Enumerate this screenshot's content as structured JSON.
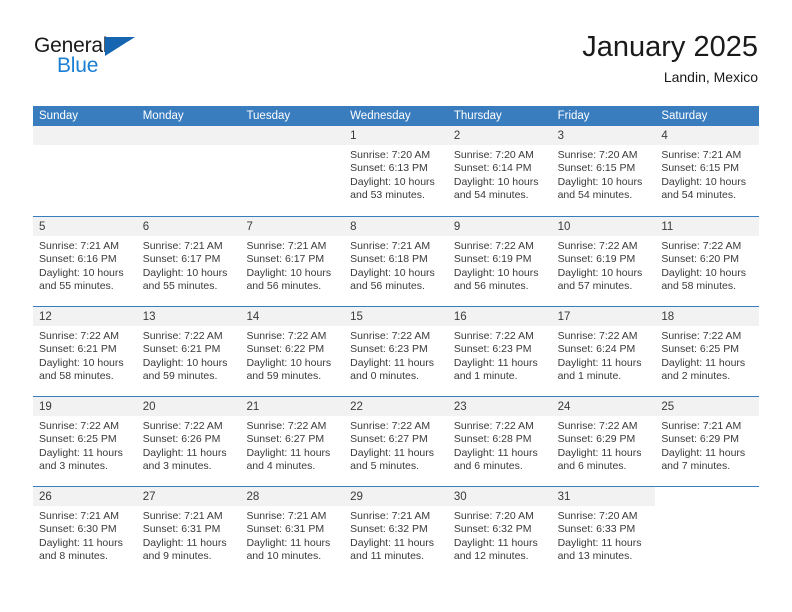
{
  "brand": {
    "name_top": "General",
    "name_bottom": "Blue",
    "accent_color": "#1b7fd4",
    "flag_color": "#1565b0"
  },
  "header": {
    "title": "January 2025",
    "subtitle": "Landin, Mexico"
  },
  "calendar": {
    "header_color": "#3a7dbf",
    "cell_strip_color": "#f2f2f2",
    "weekdays": [
      "Sunday",
      "Monday",
      "Tuesday",
      "Wednesday",
      "Thursday",
      "Friday",
      "Saturday"
    ],
    "weeks": [
      [
        {
          "day": "",
          "empty": true
        },
        {
          "day": "",
          "empty": true
        },
        {
          "day": "",
          "empty": true
        },
        {
          "day": "1",
          "sunrise": "Sunrise: 7:20 AM",
          "sunset": "Sunset: 6:13 PM",
          "daylight_1": "Daylight: 10 hours",
          "daylight_2": "and 53 minutes."
        },
        {
          "day": "2",
          "sunrise": "Sunrise: 7:20 AM",
          "sunset": "Sunset: 6:14 PM",
          "daylight_1": "Daylight: 10 hours",
          "daylight_2": "and 54 minutes."
        },
        {
          "day": "3",
          "sunrise": "Sunrise: 7:20 AM",
          "sunset": "Sunset: 6:15 PM",
          "daylight_1": "Daylight: 10 hours",
          "daylight_2": "and 54 minutes."
        },
        {
          "day": "4",
          "sunrise": "Sunrise: 7:21 AM",
          "sunset": "Sunset: 6:15 PM",
          "daylight_1": "Daylight: 10 hours",
          "daylight_2": "and 54 minutes."
        }
      ],
      [
        {
          "day": "5",
          "sunrise": "Sunrise: 7:21 AM",
          "sunset": "Sunset: 6:16 PM",
          "daylight_1": "Daylight: 10 hours",
          "daylight_2": "and 55 minutes."
        },
        {
          "day": "6",
          "sunrise": "Sunrise: 7:21 AM",
          "sunset": "Sunset: 6:17 PM",
          "daylight_1": "Daylight: 10 hours",
          "daylight_2": "and 55 minutes."
        },
        {
          "day": "7",
          "sunrise": "Sunrise: 7:21 AM",
          "sunset": "Sunset: 6:17 PM",
          "daylight_1": "Daylight: 10 hours",
          "daylight_2": "and 56 minutes."
        },
        {
          "day": "8",
          "sunrise": "Sunrise: 7:21 AM",
          "sunset": "Sunset: 6:18 PM",
          "daylight_1": "Daylight: 10 hours",
          "daylight_2": "and 56 minutes."
        },
        {
          "day": "9",
          "sunrise": "Sunrise: 7:22 AM",
          "sunset": "Sunset: 6:19 PM",
          "daylight_1": "Daylight: 10 hours",
          "daylight_2": "and 56 minutes."
        },
        {
          "day": "10",
          "sunrise": "Sunrise: 7:22 AM",
          "sunset": "Sunset: 6:19 PM",
          "daylight_1": "Daylight: 10 hours",
          "daylight_2": "and 57 minutes."
        },
        {
          "day": "11",
          "sunrise": "Sunrise: 7:22 AM",
          "sunset": "Sunset: 6:20 PM",
          "daylight_1": "Daylight: 10 hours",
          "daylight_2": "and 58 minutes."
        }
      ],
      [
        {
          "day": "12",
          "sunrise": "Sunrise: 7:22 AM",
          "sunset": "Sunset: 6:21 PM",
          "daylight_1": "Daylight: 10 hours",
          "daylight_2": "and 58 minutes."
        },
        {
          "day": "13",
          "sunrise": "Sunrise: 7:22 AM",
          "sunset": "Sunset: 6:21 PM",
          "daylight_1": "Daylight: 10 hours",
          "daylight_2": "and 59 minutes."
        },
        {
          "day": "14",
          "sunrise": "Sunrise: 7:22 AM",
          "sunset": "Sunset: 6:22 PM",
          "daylight_1": "Daylight: 10 hours",
          "daylight_2": "and 59 minutes."
        },
        {
          "day": "15",
          "sunrise": "Sunrise: 7:22 AM",
          "sunset": "Sunset: 6:23 PM",
          "daylight_1": "Daylight: 11 hours",
          "daylight_2": "and 0 minutes."
        },
        {
          "day": "16",
          "sunrise": "Sunrise: 7:22 AM",
          "sunset": "Sunset: 6:23 PM",
          "daylight_1": "Daylight: 11 hours",
          "daylight_2": "and 1 minute."
        },
        {
          "day": "17",
          "sunrise": "Sunrise: 7:22 AM",
          "sunset": "Sunset: 6:24 PM",
          "daylight_1": "Daylight: 11 hours",
          "daylight_2": "and 1 minute."
        },
        {
          "day": "18",
          "sunrise": "Sunrise: 7:22 AM",
          "sunset": "Sunset: 6:25 PM",
          "daylight_1": "Daylight: 11 hours",
          "daylight_2": "and 2 minutes."
        }
      ],
      [
        {
          "day": "19",
          "sunrise": "Sunrise: 7:22 AM",
          "sunset": "Sunset: 6:25 PM",
          "daylight_1": "Daylight: 11 hours",
          "daylight_2": "and 3 minutes."
        },
        {
          "day": "20",
          "sunrise": "Sunrise: 7:22 AM",
          "sunset": "Sunset: 6:26 PM",
          "daylight_1": "Daylight: 11 hours",
          "daylight_2": "and 3 minutes."
        },
        {
          "day": "21",
          "sunrise": "Sunrise: 7:22 AM",
          "sunset": "Sunset: 6:27 PM",
          "daylight_1": "Daylight: 11 hours",
          "daylight_2": "and 4 minutes."
        },
        {
          "day": "22",
          "sunrise": "Sunrise: 7:22 AM",
          "sunset": "Sunset: 6:27 PM",
          "daylight_1": "Daylight: 11 hours",
          "daylight_2": "and 5 minutes."
        },
        {
          "day": "23",
          "sunrise": "Sunrise: 7:22 AM",
          "sunset": "Sunset: 6:28 PM",
          "daylight_1": "Daylight: 11 hours",
          "daylight_2": "and 6 minutes."
        },
        {
          "day": "24",
          "sunrise": "Sunrise: 7:22 AM",
          "sunset": "Sunset: 6:29 PM",
          "daylight_1": "Daylight: 11 hours",
          "daylight_2": "and 6 minutes."
        },
        {
          "day": "25",
          "sunrise": "Sunrise: 7:21 AM",
          "sunset": "Sunset: 6:29 PM",
          "daylight_1": "Daylight: 11 hours",
          "daylight_2": "and 7 minutes."
        }
      ],
      [
        {
          "day": "26",
          "sunrise": "Sunrise: 7:21 AM",
          "sunset": "Sunset: 6:30 PM",
          "daylight_1": "Daylight: 11 hours",
          "daylight_2": "and 8 minutes."
        },
        {
          "day": "27",
          "sunrise": "Sunrise: 7:21 AM",
          "sunset": "Sunset: 6:31 PM",
          "daylight_1": "Daylight: 11 hours",
          "daylight_2": "and 9 minutes."
        },
        {
          "day": "28",
          "sunrise": "Sunrise: 7:21 AM",
          "sunset": "Sunset: 6:31 PM",
          "daylight_1": "Daylight: 11 hours",
          "daylight_2": "and 10 minutes."
        },
        {
          "day": "29",
          "sunrise": "Sunrise: 7:21 AM",
          "sunset": "Sunset: 6:32 PM",
          "daylight_1": "Daylight: 11 hours",
          "daylight_2": "and 11 minutes."
        },
        {
          "day": "30",
          "sunrise": "Sunrise: 7:20 AM",
          "sunset": "Sunset: 6:32 PM",
          "daylight_1": "Daylight: 11 hours",
          "daylight_2": "and 12 minutes."
        },
        {
          "day": "31",
          "sunrise": "Sunrise: 7:20 AM",
          "sunset": "Sunset: 6:33 PM",
          "daylight_1": "Daylight: 11 hours",
          "daylight_2": "and 13 minutes."
        },
        {
          "day": "",
          "empty": true,
          "blank_tail": true
        }
      ]
    ]
  }
}
